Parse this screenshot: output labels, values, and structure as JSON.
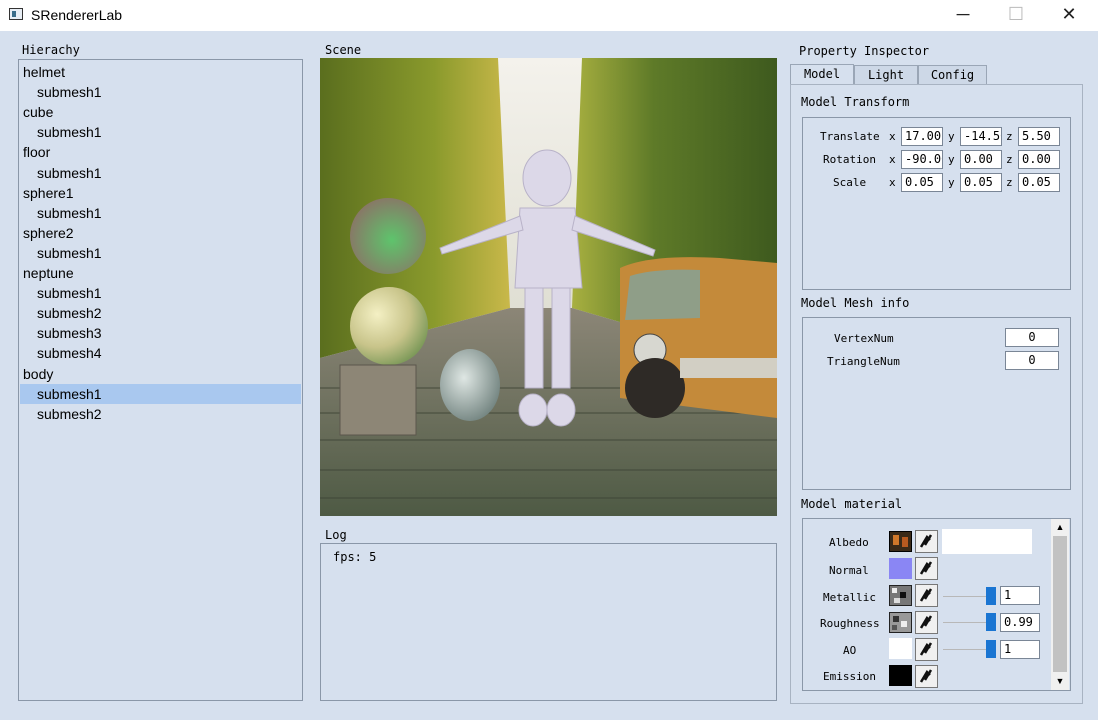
{
  "window": {
    "title": "SRendererLab",
    "minimize": "─",
    "maximize": "☐",
    "close": "✕"
  },
  "hierarchy": {
    "title": "Hierachy",
    "items": [
      {
        "label": "helmet",
        "depth": 0
      },
      {
        "label": "submesh1",
        "depth": 1
      },
      {
        "label": "cube",
        "depth": 0
      },
      {
        "label": "submesh1",
        "depth": 1
      },
      {
        "label": "floor",
        "depth": 0
      },
      {
        "label": "submesh1",
        "depth": 1
      },
      {
        "label": "sphere1",
        "depth": 0
      },
      {
        "label": "submesh1",
        "depth": 1
      },
      {
        "label": "sphere2",
        "depth": 0
      },
      {
        "label": "submesh1",
        "depth": 1
      },
      {
        "label": "neptune",
        "depth": 0
      },
      {
        "label": "submesh1",
        "depth": 1
      },
      {
        "label": "submesh2",
        "depth": 1
      },
      {
        "label": "submesh3",
        "depth": 1
      },
      {
        "label": "submesh4",
        "depth": 1
      },
      {
        "label": "body",
        "depth": 0
      },
      {
        "label": "submesh1",
        "depth": 1,
        "selected": true
      },
      {
        "label": "submesh2",
        "depth": 1
      }
    ]
  },
  "scene": {
    "title": "Scene"
  },
  "log": {
    "title": "Log",
    "text": "fps: 5"
  },
  "inspector": {
    "title": "Property Inspector",
    "tabs": [
      "Model",
      "Light",
      "Config"
    ],
    "active_tab": "Model",
    "transform": {
      "title": "Model Transform",
      "rows": [
        {
          "label": "Translate",
          "x": "17.00",
          "y": "-14.50",
          "z": "5.50"
        },
        {
          "label": "Rotation",
          "x": "-90.00",
          "y": "0.00",
          "z": "0.00"
        },
        {
          "label": "Scale",
          "x": "0.05",
          "y": "0.05",
          "z": "0.05"
        }
      ],
      "axis": {
        "x": "x",
        "y": "y",
        "z": "z"
      }
    },
    "mesh": {
      "title": "Model Mesh info",
      "vertex_label": "VertexNum",
      "vertex_value": "0",
      "triangle_label": "TriangleNum",
      "triangle_value": "0"
    },
    "material": {
      "title": "Model material",
      "rows": [
        {
          "label": "Albedo"
        },
        {
          "label": "Normal"
        },
        {
          "label": "Metallic",
          "value": "1",
          "level": 1.0
        },
        {
          "label": "Roughness",
          "value": "0.99",
          "level": 0.99
        },
        {
          "label": "AO",
          "value": "1",
          "level": 1.0
        },
        {
          "label": "Emission"
        }
      ],
      "scroll_up": "▲",
      "scroll_down": "▼"
    }
  },
  "colors": {
    "selection": "#a9c8ef",
    "background": "#d6e0ee",
    "slider": "#1a75d2"
  }
}
